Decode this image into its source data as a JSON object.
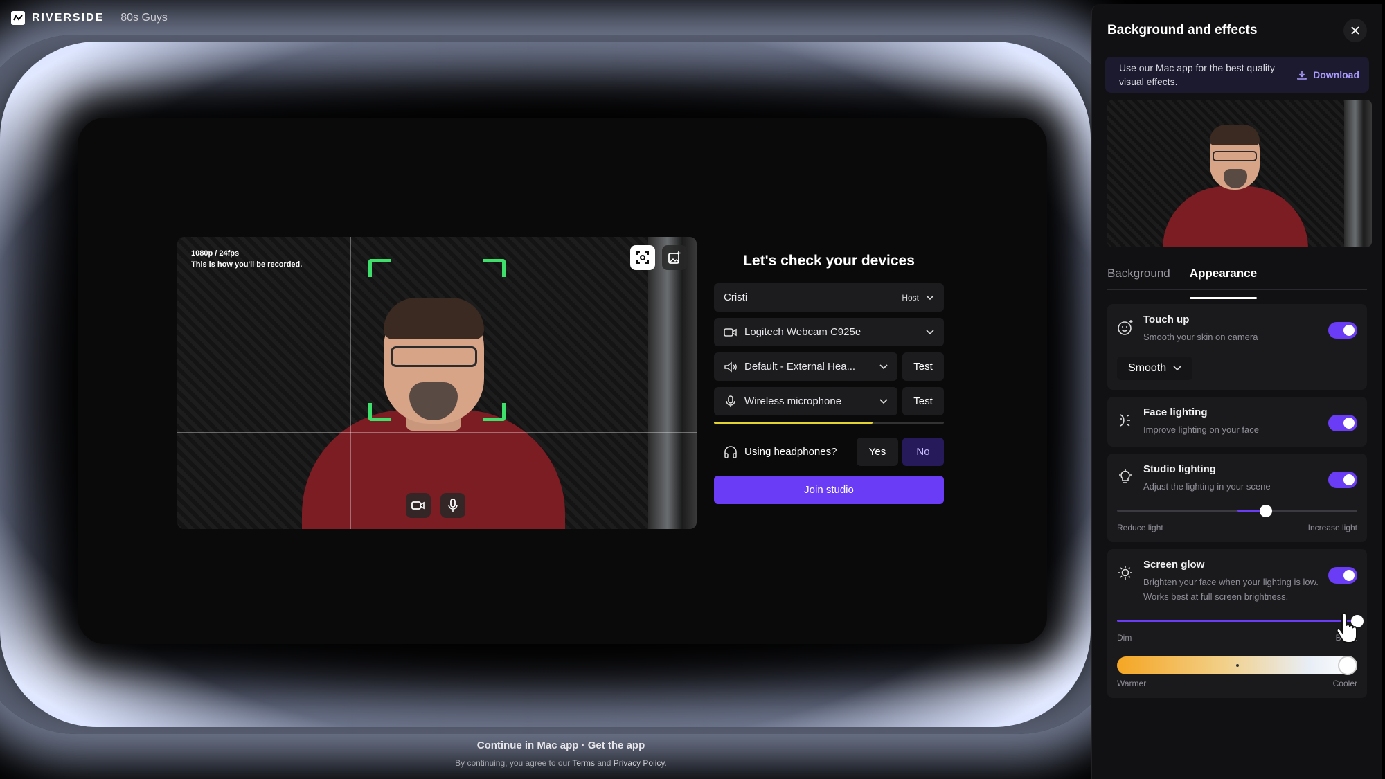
{
  "app": {
    "brand": "RIVERSIDE",
    "session_name": "80s Guys"
  },
  "preview": {
    "resolution": "1080p / 24fps",
    "note": "This is how you'll be recorded."
  },
  "devices": {
    "title": "Let's check your devices",
    "name_value": "Cristi",
    "role": "Host",
    "camera": "Logitech Webcam C925e",
    "speaker": "Default - External Hea...",
    "speaker_test": "Test",
    "microphone": "Wireless microphone",
    "mic_test": "Test",
    "mic_level": 0.69,
    "headphones_question": "Using headphones?",
    "yes": "Yes",
    "no": "No",
    "join": "Join studio"
  },
  "footer": {
    "continue": "Continue in Mac app · Get the app",
    "legal_prefix": "By continuing, you agree to our",
    "terms": "Terms",
    "and": "and",
    "privacy": "Privacy Policy",
    "suffix": "."
  },
  "panel": {
    "title": "Background and effects",
    "banner_text": "Use our Mac app for the best quality visual effects.",
    "download": "Download",
    "tabs": [
      {
        "label": "Background"
      },
      {
        "label": "Appearance"
      }
    ],
    "touch_up": {
      "title": "Touch up",
      "desc": "Smooth your skin on camera",
      "mode": "Smooth",
      "enabled": true
    },
    "face_lighting": {
      "title": "Face lighting",
      "desc": "Improve lighting on your face",
      "enabled": true
    },
    "studio_lighting": {
      "title": "Studio lighting",
      "desc": "Adjust the lighting in your scene",
      "enabled": true,
      "value": 0.62,
      "min_label": "Reduce light",
      "max_label": "Increase light"
    },
    "screen_glow": {
      "title": "Screen glow",
      "desc": "Brighten your face when your lighting is low. Works best at full screen brightness.",
      "enabled": true,
      "brightness": 1.0,
      "min_label": "Dim",
      "max_label": "Bright",
      "temperature": 0.96,
      "warm_label": "Warmer",
      "cool_label": "Cooler"
    }
  },
  "colors": {
    "accent": "#6a3cf5",
    "frame_green": "#3ee06b",
    "glow": "#dbe4ff"
  }
}
